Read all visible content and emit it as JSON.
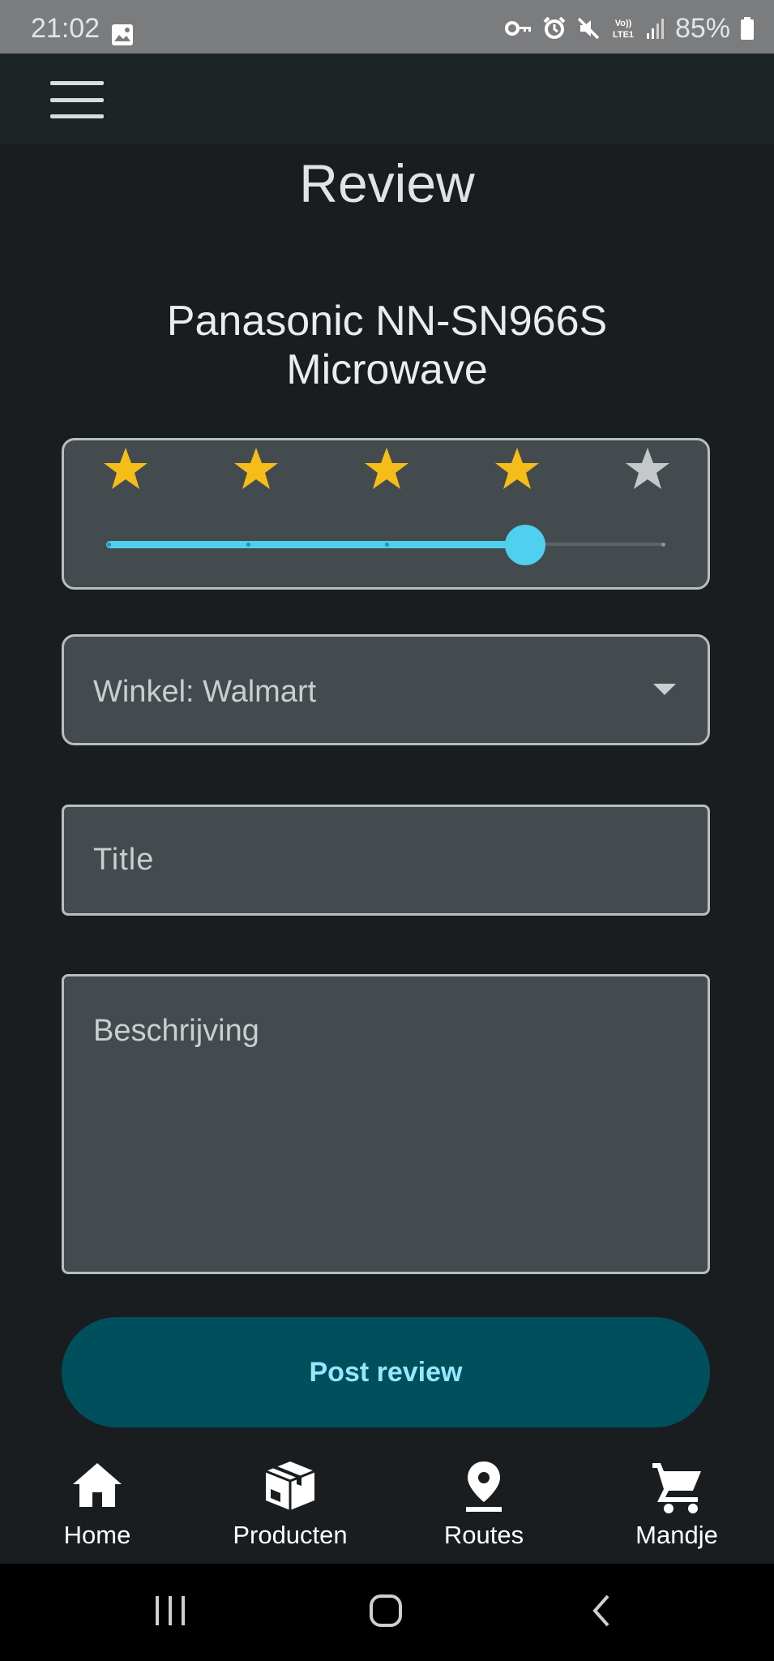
{
  "status_bar": {
    "time": "21:02",
    "battery_percent": "85%",
    "icons": [
      "image-icon",
      "key-icon",
      "alarm-icon",
      "mute-icon",
      "volte-icon",
      "signal-icon",
      "battery-icon"
    ]
  },
  "app_bar": {
    "menu_icon": "hamburger-menu-icon"
  },
  "page": {
    "title": "Review",
    "product_name": "Panasonic NN-SN966S Microwave"
  },
  "rating": {
    "value": 4,
    "max": 5,
    "star_color_active": "#f6bc17",
    "star_color_inactive": "#c5c8ca",
    "slider_color": "#4fd0ee"
  },
  "store_dropdown": {
    "selected_text": "Winkel: Walmart"
  },
  "title_input": {
    "placeholder": "Title",
    "value": ""
  },
  "description_input": {
    "placeholder": "Beschrijving",
    "value": ""
  },
  "post_button": {
    "label": "Post review"
  },
  "bottom_nav": {
    "items": [
      {
        "label": "Home",
        "icon": "home-icon"
      },
      {
        "label": "Producten",
        "icon": "package-icon"
      },
      {
        "label": "Routes",
        "icon": "location-pin-icon"
      },
      {
        "label": "Mandje",
        "icon": "cart-icon"
      }
    ]
  },
  "system_nav": {
    "buttons": [
      "recents-button",
      "home-button",
      "back-button"
    ]
  }
}
